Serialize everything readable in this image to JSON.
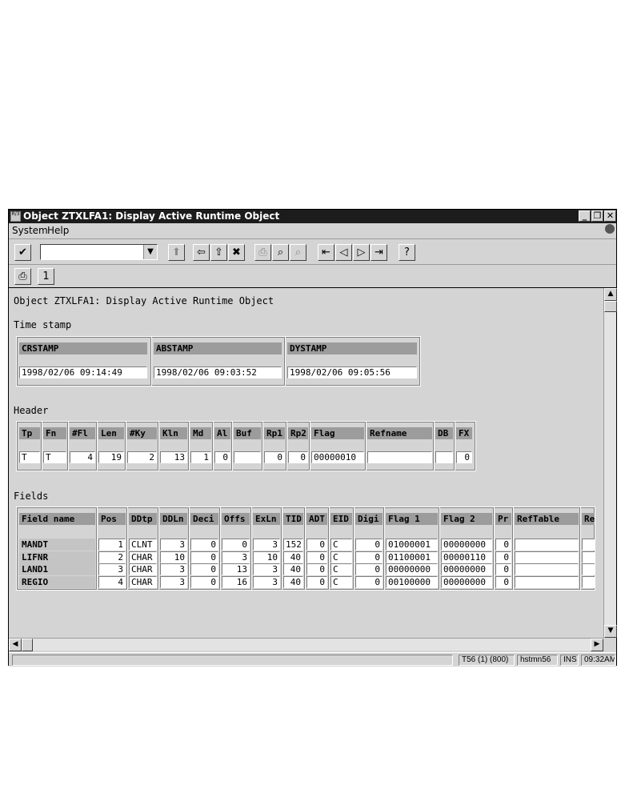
{
  "window": {
    "title": "Object ZTXLFA1:  Display Active Runtime Object",
    "app_icon": "sap-icon",
    "minimize": "_",
    "restore": "❐",
    "close": "✕"
  },
  "menubar": {
    "items": [
      "System",
      "Help"
    ]
  },
  "toolbar": {
    "command_value": "",
    "dropdown": "▼",
    "enter_icon": "✔",
    "save_icon": "⬆",
    "back_icon": "⇦",
    "exit_icon": "⇧",
    "cancel_icon": "✖",
    "print_icon": "⎙",
    "find_icon": "⌕",
    "find_next_icon": "⌕",
    "first_page_icon": "⇤",
    "prev_page_icon": "◁",
    "next_page_icon": "▷",
    "last_page_icon": "⇥",
    "help_icon": "?",
    "tb2_print_icon": "⎙",
    "tb2_detail_icon": "1"
  },
  "main": {
    "heading": "Object ZTXLFA1:  Display Active Runtime Object",
    "timestamp_section": "Time stamp",
    "timestamp": {
      "headers": [
        "CRSTAMP",
        "ABSTAMP",
        "DYSTAMP"
      ],
      "values": [
        "1998/02/06  09:14:49",
        "1998/02/06  09:03:52",
        "1998/02/06  09:05:56"
      ]
    },
    "header_section": "Header",
    "header_table": {
      "headers": [
        "Tp",
        "Fn",
        "#Fl",
        "Len",
        "#Ky",
        "Kln",
        "Md",
        "Al",
        "Buf",
        "Rp1",
        "Rp2",
        "Flag",
        "Refname",
        "DB",
        "FX"
      ],
      "values": [
        "T",
        "T",
        "4",
        "19",
        "2",
        "13",
        "1",
        "0",
        "",
        "0",
        "0",
        "00000010",
        "",
        "",
        "0"
      ]
    },
    "fields_section": "Fields",
    "fields_table": {
      "headers": [
        "Field name",
        "Pos",
        "DDtp",
        "DDLn",
        "Deci",
        "Offs",
        "ExLn",
        "TID",
        "ADT",
        "EID",
        "Digi",
        "Flag 1",
        "Flag 2",
        "Pr",
        "RefTable",
        "Re"
      ],
      "rows": [
        [
          "MANDT",
          "1",
          "CLNT",
          "3",
          "0",
          "0",
          "3",
          "152",
          "0",
          "C",
          "0",
          "01000001",
          "00000000",
          "0",
          "",
          ""
        ],
        [
          "LIFNR",
          "2",
          "CHAR",
          "10",
          "0",
          "3",
          "10",
          "40",
          "0",
          "C",
          "0",
          "01100001",
          "00000110",
          "0",
          "",
          ""
        ],
        [
          "LAND1",
          "3",
          "CHAR",
          "3",
          "0",
          "13",
          "3",
          "40",
          "0",
          "C",
          "0",
          "00000000",
          "00000000",
          "0",
          "",
          ""
        ],
        [
          "REGIO",
          "4",
          "CHAR",
          "3",
          "0",
          "16",
          "3",
          "40",
          "0",
          "C",
          "0",
          "00100000",
          "00000000",
          "0",
          "",
          ""
        ]
      ]
    }
  },
  "scrollbars": {
    "up": "▲",
    "down": "▼",
    "left": "◀",
    "right": "▶"
  },
  "statusbar": {
    "message": "",
    "system": "T56 (1) (800)",
    "server": "hstmn56",
    "mode": "INS",
    "time": "09:32AM"
  }
}
